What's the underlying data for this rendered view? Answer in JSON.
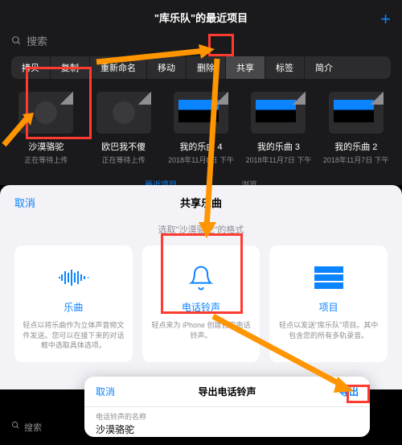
{
  "hdr": {
    "title": "\"库乐队\"的最近项目",
    "plus": "+",
    "search": "搜索"
  },
  "tabs": [
    "拷贝",
    "复制",
    "重新命名",
    "移动",
    "删除",
    "共享",
    "标签",
    "简介"
  ],
  "items": [
    {
      "name": "沙漠骆驼",
      "sub": "正在等待上传",
      "g": true
    },
    {
      "name": "欧巴我不傻",
      "sub": "正在等待上传",
      "g": true
    },
    {
      "name": "我的乐曲 4",
      "sub": "2018年11月8日 下午"
    },
    {
      "name": "我的乐曲 3",
      "sub": "2018年11月7日 下午"
    },
    {
      "name": "我的乐曲 2",
      "sub": "2018年11月7日 下午"
    }
  ],
  "btm": [
    "最近项目",
    "浏览"
  ],
  "sheet": {
    "cancel": "取消",
    "title": "共享乐曲",
    "sub": "选取\"沙漠骆驼\"的格式"
  },
  "cards": [
    {
      "name": "乐曲",
      "desc": "轻点以将乐曲作为立体声音频文件发送。您可以在接下来的对话框中选取具体选项。"
    },
    {
      "name": "电话铃声",
      "desc": "轻点来为 iPhone 创建自定电话铃声。"
    },
    {
      "name": "项目",
      "desc": "轻点以发送\"库乐队\"项目。其中包含您的所有多轨录音。"
    }
  ],
  "exp": {
    "cancel": "取消",
    "title": "导出电话铃声",
    "ok": "导出",
    "lab": "电话铃声的名称",
    "val": "沙漠骆驼"
  }
}
